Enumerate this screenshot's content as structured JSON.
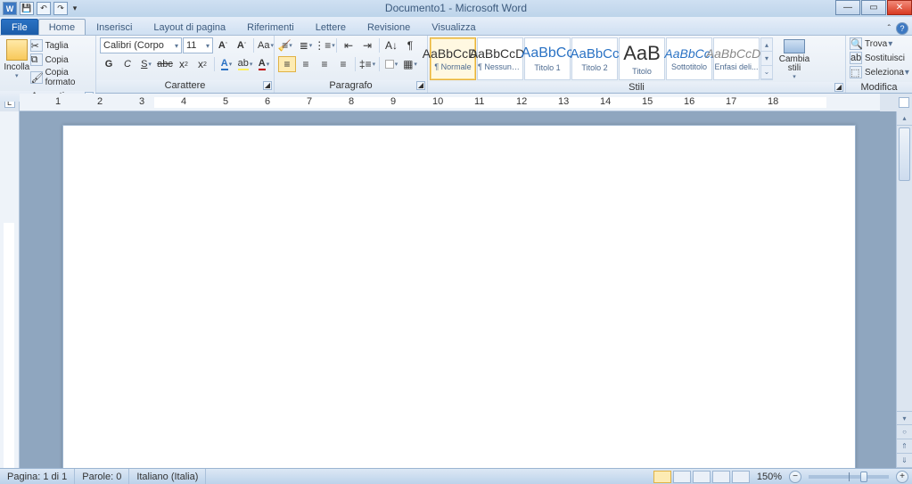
{
  "title": "Documento1 - Microsoft Word",
  "qat": {
    "w": "W"
  },
  "tabs": {
    "file": "File",
    "items": [
      "Home",
      "Inserisci",
      "Layout di pagina",
      "Riferimenti",
      "Lettere",
      "Revisione",
      "Visualizza"
    ],
    "active": 0
  },
  "clipboard": {
    "paste": "Incolla",
    "cut": "Taglia",
    "copy": "Copia",
    "format_painter": "Copia formato",
    "label": "Appunti"
  },
  "font": {
    "family": "Calibri (Corpo",
    "size": "11",
    "grow": "A",
    "shrink": "A",
    "case": "Aa",
    "clear": "",
    "bold": "G",
    "italic": "C",
    "underline": "S",
    "strike": "abc",
    "sub": "x",
    "sup": "x",
    "label": "Carattere"
  },
  "para": {
    "label": "Paragrafo"
  },
  "styles": {
    "label": "Stili",
    "change": "Cambia stili",
    "items": [
      {
        "prev": "AaBbCcDc",
        "name": "¶ Normale",
        "big": false
      },
      {
        "prev": "AaBbCcDc",
        "name": "¶ Nessuna...",
        "big": false
      },
      {
        "prev": "AaBbCc",
        "name": "Titolo 1",
        "big": true
      },
      {
        "prev": "AaBbCc",
        "name": "Titolo 2",
        "big": true
      },
      {
        "prev": "AaB",
        "name": "Titolo",
        "big": true
      },
      {
        "prev": "AaBbCc.",
        "name": "Sottotitolo",
        "big": false
      },
      {
        "prev": "AaBbCcDc",
        "name": "Enfasi deli...",
        "big": false
      }
    ]
  },
  "editing": {
    "find": "Trova",
    "replace": "Sostituisci",
    "select": "Seleziona",
    "label": "Modifica"
  },
  "status": {
    "page": "Pagina: 1 di 1",
    "words": "Parole: 0",
    "lang": "Italiano (Italia)",
    "zoom": "150%"
  },
  "ruler_numbers": [
    1,
    2,
    3,
    4,
    5,
    6,
    7,
    8,
    9,
    10,
    11,
    12,
    13,
    14,
    15,
    16,
    17,
    18
  ]
}
